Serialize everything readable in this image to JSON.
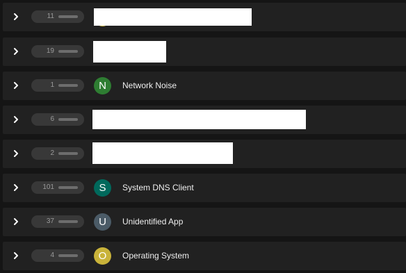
{
  "rows": [
    {
      "count": "11",
      "redacted": true
    },
    {
      "count": "19",
      "redacted": true
    },
    {
      "count": "1",
      "initial": "N",
      "name": "Network Noise",
      "color": "#2e7d32"
    },
    {
      "count": "6",
      "redacted": true
    },
    {
      "count": "2",
      "redacted": true
    },
    {
      "count": "101",
      "initial": "S",
      "name": "System DNS Client",
      "color": "#00695c"
    },
    {
      "count": "37",
      "initial": "U",
      "name": "Unidentified App",
      "color": "#4b5b67"
    },
    {
      "count": "4",
      "initial": "O",
      "name": "Operating System",
      "color": "#c9b33a"
    }
  ],
  "icons": {
    "expand": "chevron-right-icon"
  }
}
